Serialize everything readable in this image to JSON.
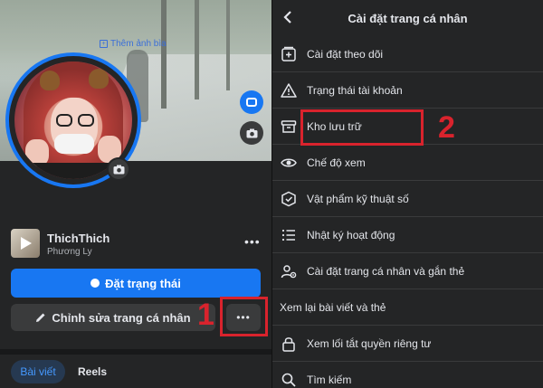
{
  "left": {
    "add_cover_label": "Thêm ảnh bìa",
    "profile_name": "ThichThich",
    "profile_subtitle": "Phương Ly",
    "more_label": "•••",
    "status_button_label": "Đặt trạng thái",
    "edit_profile_label": "Chỉnh sửa trang cá nhân",
    "more_button_label": "•••",
    "tabs": [
      {
        "label": "Bài viết",
        "active": true
      },
      {
        "label": "Reels",
        "active": false
      }
    ]
  },
  "annotations": {
    "step1": "1",
    "step2": "2",
    "highlight_color": "#d9232d"
  },
  "right": {
    "title": "Cài đặt trang cá nhân",
    "items": [
      {
        "label": "Cài đặt theo dõi",
        "icon": "follow-settings-icon"
      },
      {
        "label": "Trạng thái tài khoản",
        "icon": "warning-icon"
      },
      {
        "label": "Kho lưu trữ",
        "icon": "archive-icon"
      },
      {
        "label": "Chế độ xem",
        "icon": "eye-icon"
      },
      {
        "label": "Vật phẩm kỹ thuật số",
        "icon": "digital-items-icon"
      },
      {
        "label": "Nhật ký hoạt động",
        "icon": "activity-log-icon"
      },
      {
        "label": "Cài đặt trang cá nhân và gắn thẻ",
        "icon": "profile-tag-settings-icon"
      },
      {
        "label": "Xem lại bài viết và thẻ",
        "icon": ""
      },
      {
        "label": "Xem lối tắt quyền riêng tư",
        "icon": "lock-icon"
      },
      {
        "label": "Tìm kiếm",
        "icon": "search-icon"
      }
    ]
  },
  "colors": {
    "accent": "#1877f2",
    "background": "#242526",
    "button_secondary": "#3a3b3c"
  }
}
